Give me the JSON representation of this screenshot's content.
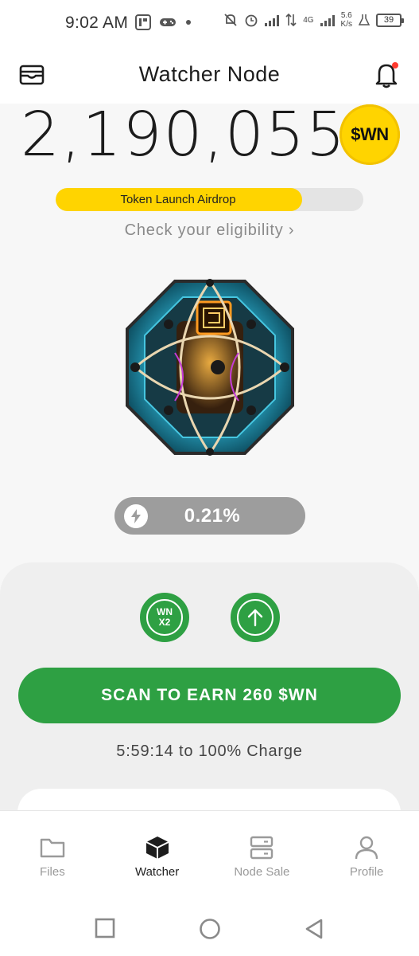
{
  "status_bar": {
    "time": "9:02 AM",
    "network": "4G",
    "speed_value": "5.6",
    "speed_unit": "K/s",
    "battery": "39"
  },
  "header": {
    "title": "Watcher Node",
    "left_icon": "wallet-icon",
    "right_icon": "bell-icon"
  },
  "balance": {
    "amount": "2,190,055",
    "token_badge": "$WN"
  },
  "airdrop": {
    "label": "Token Launch Airdrop",
    "progress_fraction": 0.8,
    "eligibility_link": "Check your eligibility ›"
  },
  "charge": {
    "icon": "bolt-icon",
    "percent": "0.21%"
  },
  "boosts": {
    "multiplier_line1": "WN",
    "multiplier_line2": "X2",
    "upgrade_icon": "arrow-up-icon"
  },
  "scan": {
    "button_label": "SCAN TO EARN 260 $WN",
    "timer_text": "5:59:14 to 100% Charge"
  },
  "bottom_nav": {
    "items": [
      {
        "label": "Files",
        "icon": "folder-icon",
        "active": false
      },
      {
        "label": "Watcher",
        "icon": "cube-icon",
        "active": true
      },
      {
        "label": "Node Sale",
        "icon": "server-icon",
        "active": false
      },
      {
        "label": "Profile",
        "icon": "person-icon",
        "active": false
      }
    ]
  },
  "colors": {
    "accent_green": "#2ea043",
    "accent_yellow": "#ffd400",
    "charge_pill": "#9d9d9d"
  }
}
